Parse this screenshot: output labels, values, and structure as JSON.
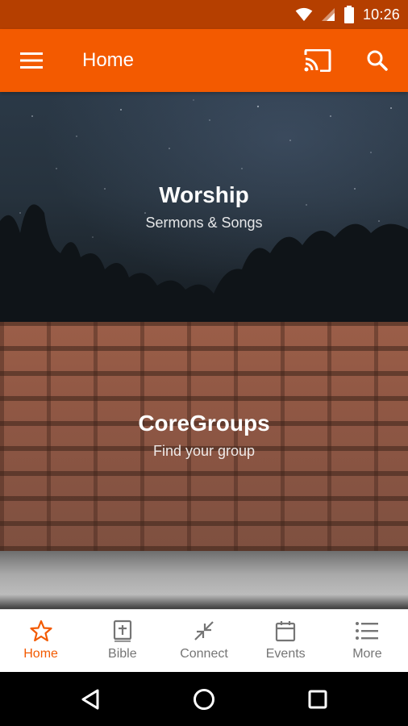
{
  "status_bar": {
    "time": "10:26"
  },
  "app_bar": {
    "title": "Home"
  },
  "cards": [
    {
      "title": "Worship",
      "subtitle": "Sermons & Songs"
    },
    {
      "title": "CoreGroups",
      "subtitle": "Find your group"
    }
  ],
  "bottom_nav": {
    "items": [
      {
        "label": "Home",
        "icon": "star-icon",
        "active": true
      },
      {
        "label": "Bible",
        "icon": "bible-icon",
        "active": false
      },
      {
        "label": "Connect",
        "icon": "collapse-arrows-icon",
        "active": false
      },
      {
        "label": "Events",
        "icon": "calendar-icon",
        "active": false
      },
      {
        "label": "More",
        "icon": "list-icon",
        "active": false
      }
    ]
  },
  "colors": {
    "primary": "#f35a00",
    "status_bar": "#b53f00",
    "inactive": "#757575"
  }
}
